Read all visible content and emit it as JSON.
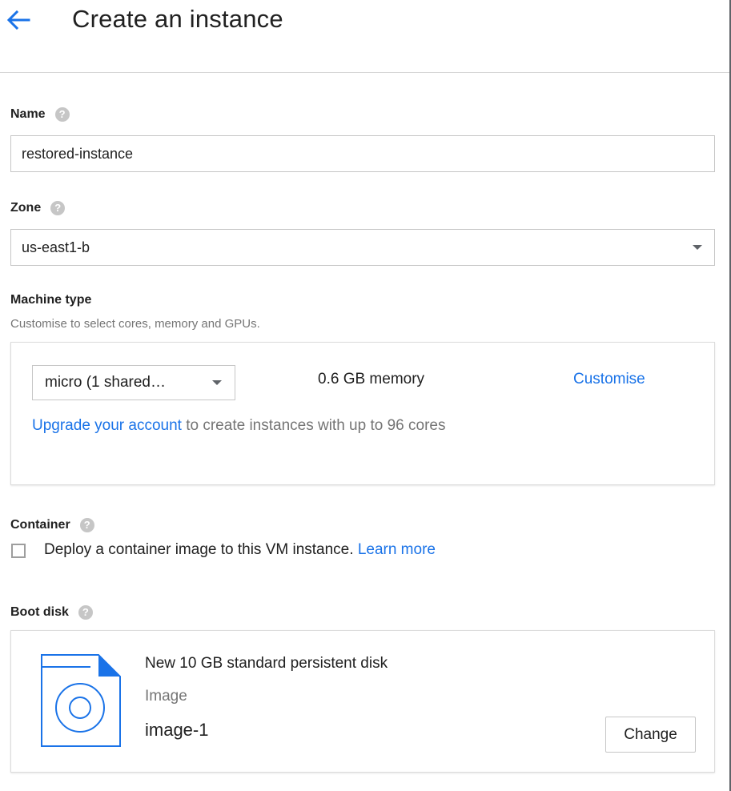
{
  "header": {
    "title": "Create an instance",
    "back_icon": "arrow-left-icon"
  },
  "colors": {
    "accent": "#1a73e8",
    "text": "#212121",
    "muted": "#757575",
    "border": "#c6c6c6"
  },
  "name_field": {
    "label": "Name",
    "value": "restored-instance",
    "help_icon": "help-circle-icon"
  },
  "zone_field": {
    "label": "Zone",
    "value": "us-east1-b",
    "help_icon": "help-circle-icon"
  },
  "machine_type": {
    "label": "Machine type",
    "subtitle": "Customise to select cores, memory and GPUs.",
    "selected": "micro (1 shared…",
    "memory": "0.6 GB memory",
    "customise_link": "Customise",
    "upgrade_link": "Upgrade your account",
    "upgrade_text": " to create instances with up to 96 cores"
  },
  "container": {
    "label": "Container",
    "checkbox_text": "Deploy a container image to this VM instance. ",
    "checked": false,
    "learn_more": "Learn more"
  },
  "boot_disk": {
    "label": "Boot disk",
    "title": "New 10 GB standard persistent disk",
    "image_label": "Image",
    "image_value": "image-1",
    "change_button": "Change",
    "icon": "disk-image-icon"
  }
}
